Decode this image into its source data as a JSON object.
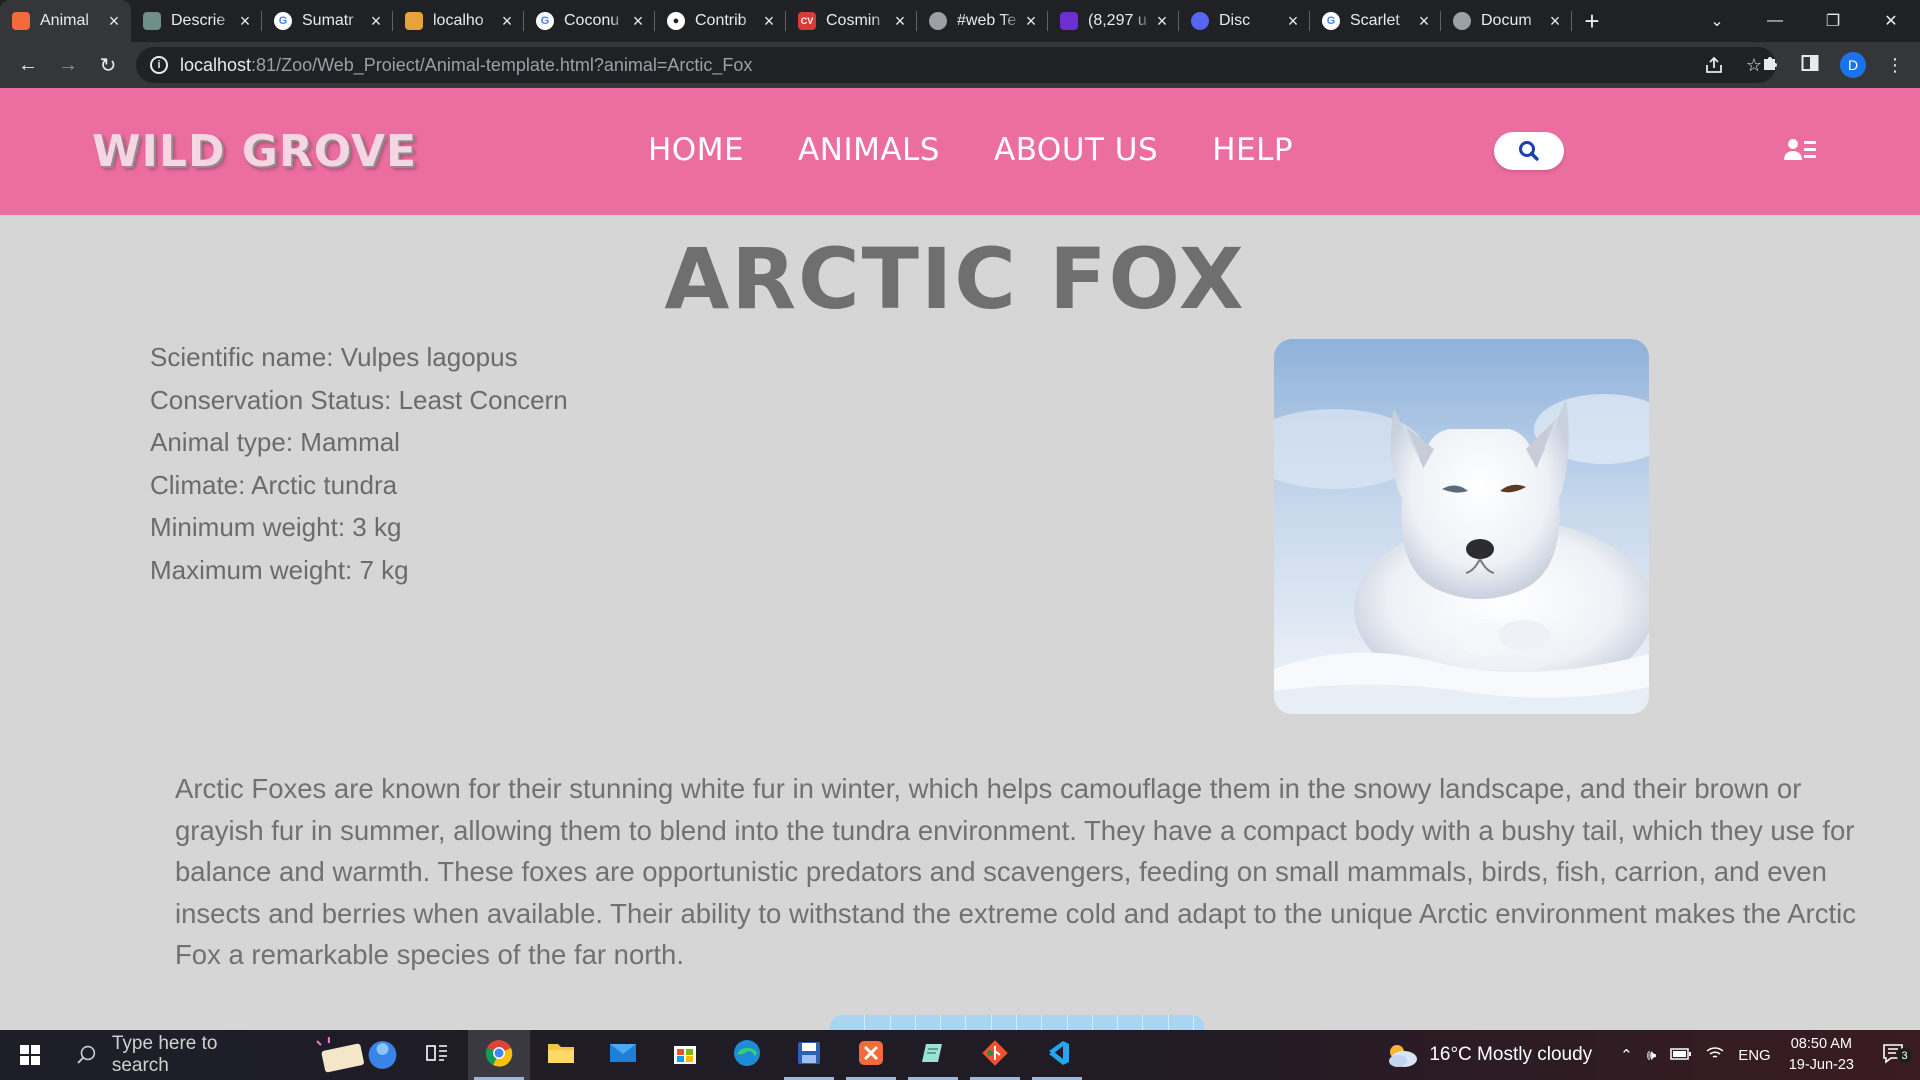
{
  "browser": {
    "tabs": [
      {
        "title": "Animal",
        "icon": "xampp-icon",
        "color": "#f36b3a",
        "active": true
      },
      {
        "title": "Descrie",
        "icon": "chatgpt-icon",
        "color": "#6e8e86"
      },
      {
        "title": "Sumatr",
        "icon": "google-icon",
        "color": "#ffffff"
      },
      {
        "title": "localho",
        "icon": "localhost-icon",
        "color": "#e8a23c"
      },
      {
        "title": "Coconu",
        "icon": "google-icon",
        "color": "#ffffff"
      },
      {
        "title": "Contrib",
        "icon": "github-icon",
        "color": "#ffffff"
      },
      {
        "title": "Cosmin",
        "icon": "cv-icon",
        "color": "#d93a3a"
      },
      {
        "title": "#web Te",
        "icon": "globe-icon",
        "color": "#9aa0a6"
      },
      {
        "title": "(8,297 u",
        "icon": "yahoo-mail-icon",
        "color": "#6b2fd3"
      },
      {
        "title": "Disc",
        "icon": "discord-icon",
        "color": "#5865f2"
      },
      {
        "title": "Scarlet",
        "icon": "google-icon",
        "color": "#ffffff"
      },
      {
        "title": "Docum",
        "icon": "globe-icon",
        "color": "#9aa0a6"
      }
    ],
    "url_host": "localhost",
    "url_rest": ":81/Zoo/Web_Proiect/Animal-template.html?animal=Arctic_Fox",
    "profile_initial": "D"
  },
  "site": {
    "logo": "WILD GROVE",
    "nav": [
      {
        "label": "HOME"
      },
      {
        "label": "ANIMALS"
      },
      {
        "label": "ABOUT US"
      },
      {
        "label": "HELP"
      }
    ],
    "header_color": "#ec6ea0"
  },
  "animal": {
    "title": "ARCTIC FOX",
    "facts": [
      {
        "label": "Scientific name",
        "value": "Vulpes lagopus",
        "text": "Scientific name: Vulpes lagopus"
      },
      {
        "label": "Conservation Status",
        "value": "Least Concern",
        "text": "Conservation Status: Least Concern"
      },
      {
        "label": "Animal type",
        "value": "Mammal",
        "text": "Animal type: Mammal"
      },
      {
        "label": "Climate",
        "value": "Arctic tundra",
        "text": "Climate: Arctic tundra"
      },
      {
        "label": "Minimum weight",
        "value": "3 kg",
        "text": "Minimum weight: 3 kg"
      },
      {
        "label": "Maximum weight",
        "value": "7 kg",
        "text": "Maximum weight: 7 kg"
      }
    ],
    "description": "Arctic Foxes are known for their stunning white fur in winter, which helps camouflage them in the snowy landscape, and their brown or grayish fur in summer, allowing them to blend into the tundra environment. They have a compact body with a bushy tail, which they use for balance and warmth. These foxes are opportunistic predators and scavengers, feeding on small mammals, birds, fish, carrion, and even insects and berries when available. Their ability to withstand the extreme cold and adapt to the unique Arctic environment makes the Arctic Fox a remarkable species of the far north."
  },
  "taskbar": {
    "search_placeholder": "Type here to search",
    "apps": [
      {
        "name": "task-view-icon"
      },
      {
        "name": "chrome-icon",
        "open": true,
        "active": true
      },
      {
        "name": "file-explorer-icon"
      },
      {
        "name": "mail-icon"
      },
      {
        "name": "microsoft-store-icon"
      },
      {
        "name": "edge-icon"
      },
      {
        "name": "save-disk-icon",
        "open": true
      },
      {
        "name": "xampp-icon",
        "open": true
      },
      {
        "name": "notepad-icon",
        "open": true
      },
      {
        "name": "git-icon",
        "open": true
      },
      {
        "name": "vscode-icon",
        "open": true
      }
    ],
    "weather": "16°C  Mostly cloudy",
    "language": "ENG",
    "time": "08:50 AM",
    "date": "19-Jun-23",
    "notifications": "3"
  }
}
